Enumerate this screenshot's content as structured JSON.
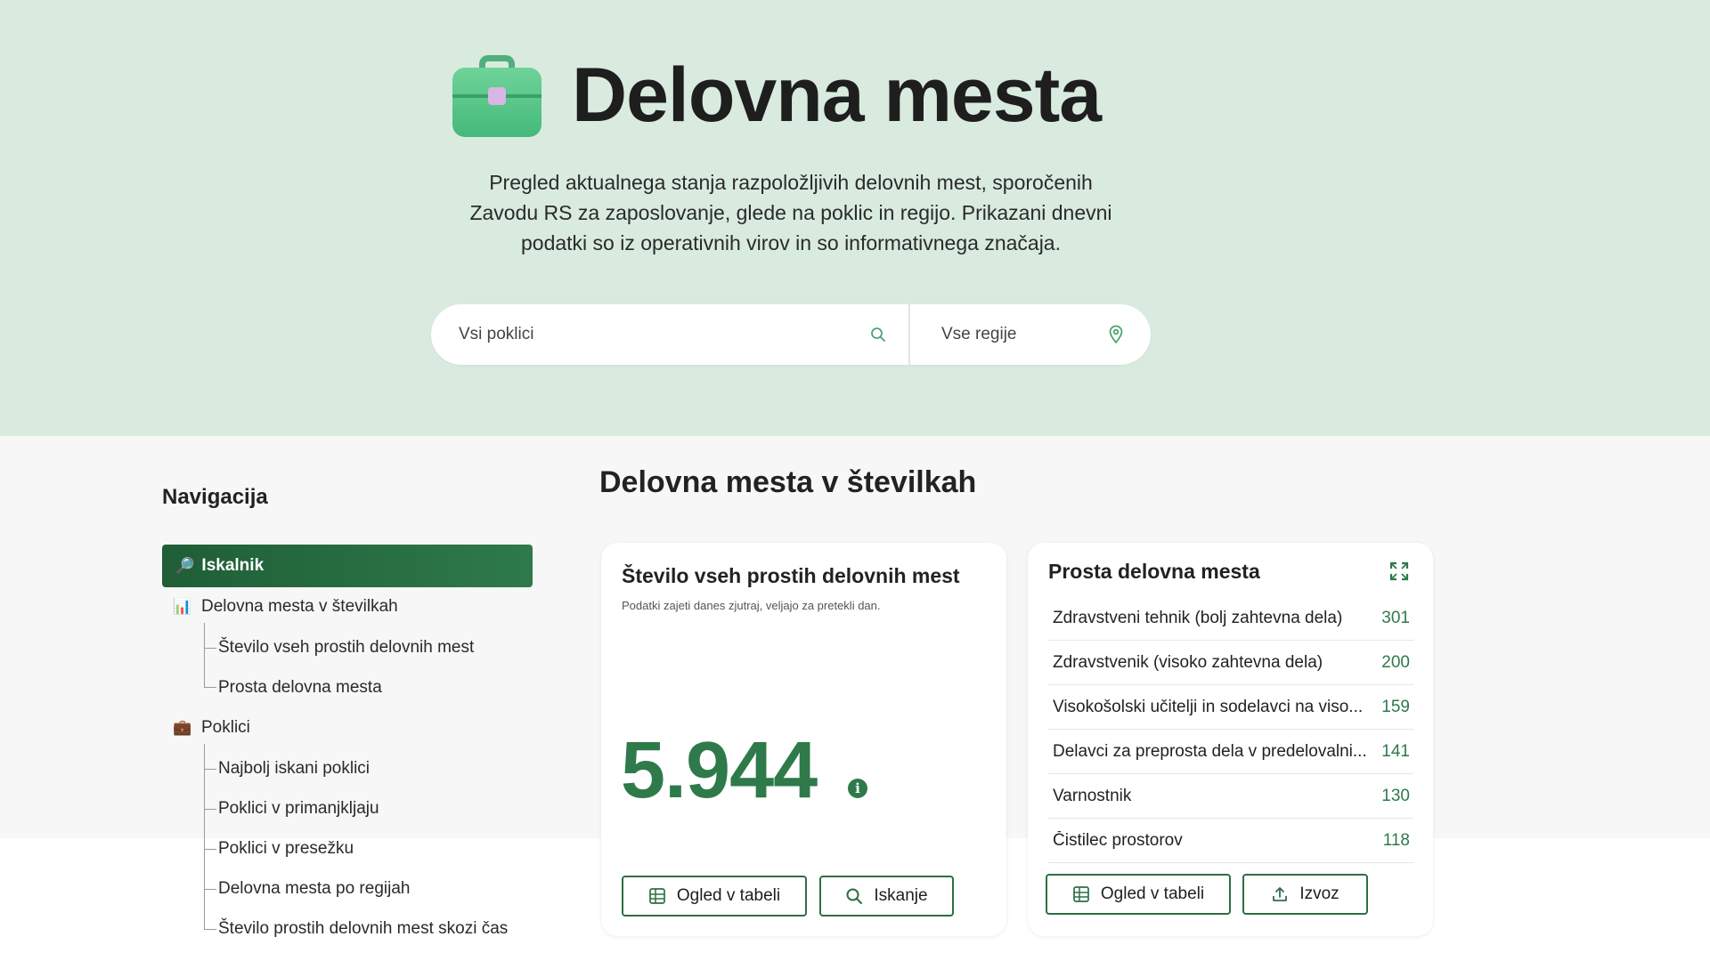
{
  "hero": {
    "title": "Delovna mesta",
    "icon": "briefcase-icon",
    "description": "Pregled aktualnega stanja razpoložljivih delovnih mest, sporočenih Zavodu RS za zaposlovanje, glede na poklic in regijo. Prikazani dnevni podatki so iz operativnih virov in so informativnega značaja."
  },
  "search": {
    "occupation_placeholder": "Vsi poklici",
    "region_placeholder": "Vse regije"
  },
  "nav": {
    "title": "Navigacija",
    "active": {
      "emoji": "🔎",
      "label": "Iskalnik"
    },
    "group1": {
      "emoji": "📊",
      "label": "Delovna mesta v številkah"
    },
    "group1_items": [
      "Število vseh prostih delovnih mest",
      "Prosta delovna mesta"
    ],
    "group2": {
      "emoji": "💼",
      "label": "Poklici"
    },
    "group2_items": [
      "Najbolj iskani poklici",
      "Poklici v primanjkljaju",
      "Poklici v presežku",
      "Delovna mesta po regijah",
      "Število prostih delovnih mest skozi čas"
    ]
  },
  "main": {
    "section_title": "Delovna mesta v številkah"
  },
  "card_total": {
    "title": "Število vseh prostih delovnih mest",
    "note": "Podatki zajeti danes zjutraj, veljajo za pretekli dan.",
    "value": "5.944",
    "btn_table": "Ogled v tabeli",
    "btn_search": "Iskanje"
  },
  "card_list": {
    "title": "Prosta delovna mesta",
    "rows": [
      {
        "label": "Zdravstveni tehnik (bolj zahtevna dela)",
        "value": "301"
      },
      {
        "label": "Zdravstvenik (visoko zahtevna dela)",
        "value": "200"
      },
      {
        "label": "Visokošolski učitelji in sodelavci na viso...",
        "value": "159"
      },
      {
        "label": "Delavci za preprosta dela v predelovalni...",
        "value": "141"
      },
      {
        "label": "Varnostnik",
        "value": "130"
      },
      {
        "label": "Čistilec prostorov",
        "value": "118"
      }
    ],
    "btn_table": "Ogled v tabeli",
    "btn_export": "Izvoz"
  },
  "colors": {
    "hero_bg": "#d9ebdf",
    "accent": "#2e7a4a",
    "nav_active": "#1f5e37"
  }
}
